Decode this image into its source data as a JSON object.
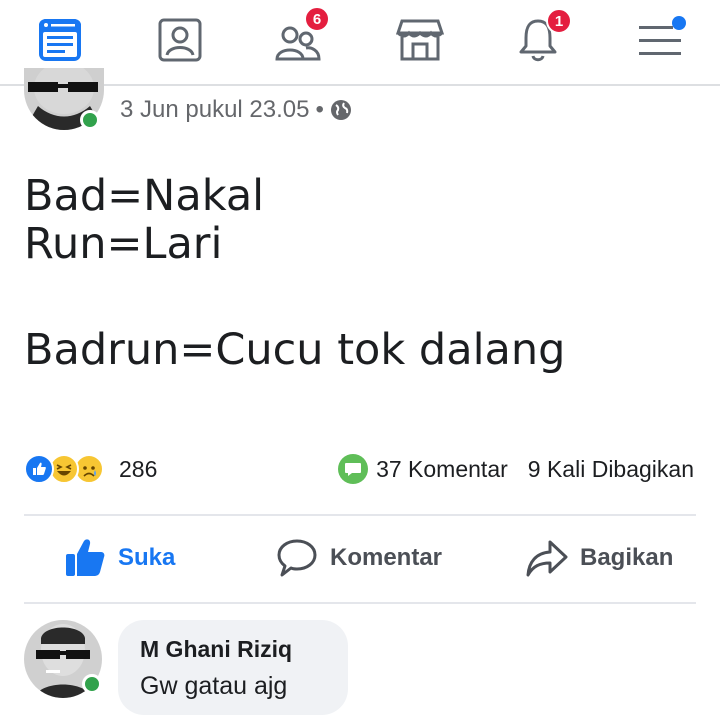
{
  "nav": {
    "items": [
      {
        "name": "news-feed-icon",
        "active": true
      },
      {
        "name": "profile-icon"
      },
      {
        "name": "friends-icon",
        "badge": "6"
      },
      {
        "name": "marketplace-icon"
      },
      {
        "name": "notifications-icon",
        "badge": "1"
      },
      {
        "name": "menu-icon"
      }
    ],
    "friends_badge": "6",
    "notifications_badge": "1"
  },
  "post": {
    "timestamp": "3 Jun pukul 23.05",
    "separator": "•",
    "privacy_icon": "globe-icon",
    "lines": [
      "Bad=Nakal",
      "Run=Lari",
      "Badrun=Cucu tok dalang"
    ],
    "reactions": [
      "like",
      "haha",
      "sad"
    ],
    "reaction_count": "286",
    "comment_count": "37 Komentar",
    "share_count": "9 Kali Dibagikan"
  },
  "actions": {
    "like_label": "Suka",
    "comment_label": "Komentar",
    "share_label": "Bagikan"
  },
  "comment": {
    "author": "M Ghani Riziq",
    "text": "Gw gatau ajg"
  },
  "colors": {
    "brand": "#1877f2",
    "badge": "#e41e3f",
    "online": "#31a24c",
    "comment_bubble": "#f0f2f5"
  }
}
